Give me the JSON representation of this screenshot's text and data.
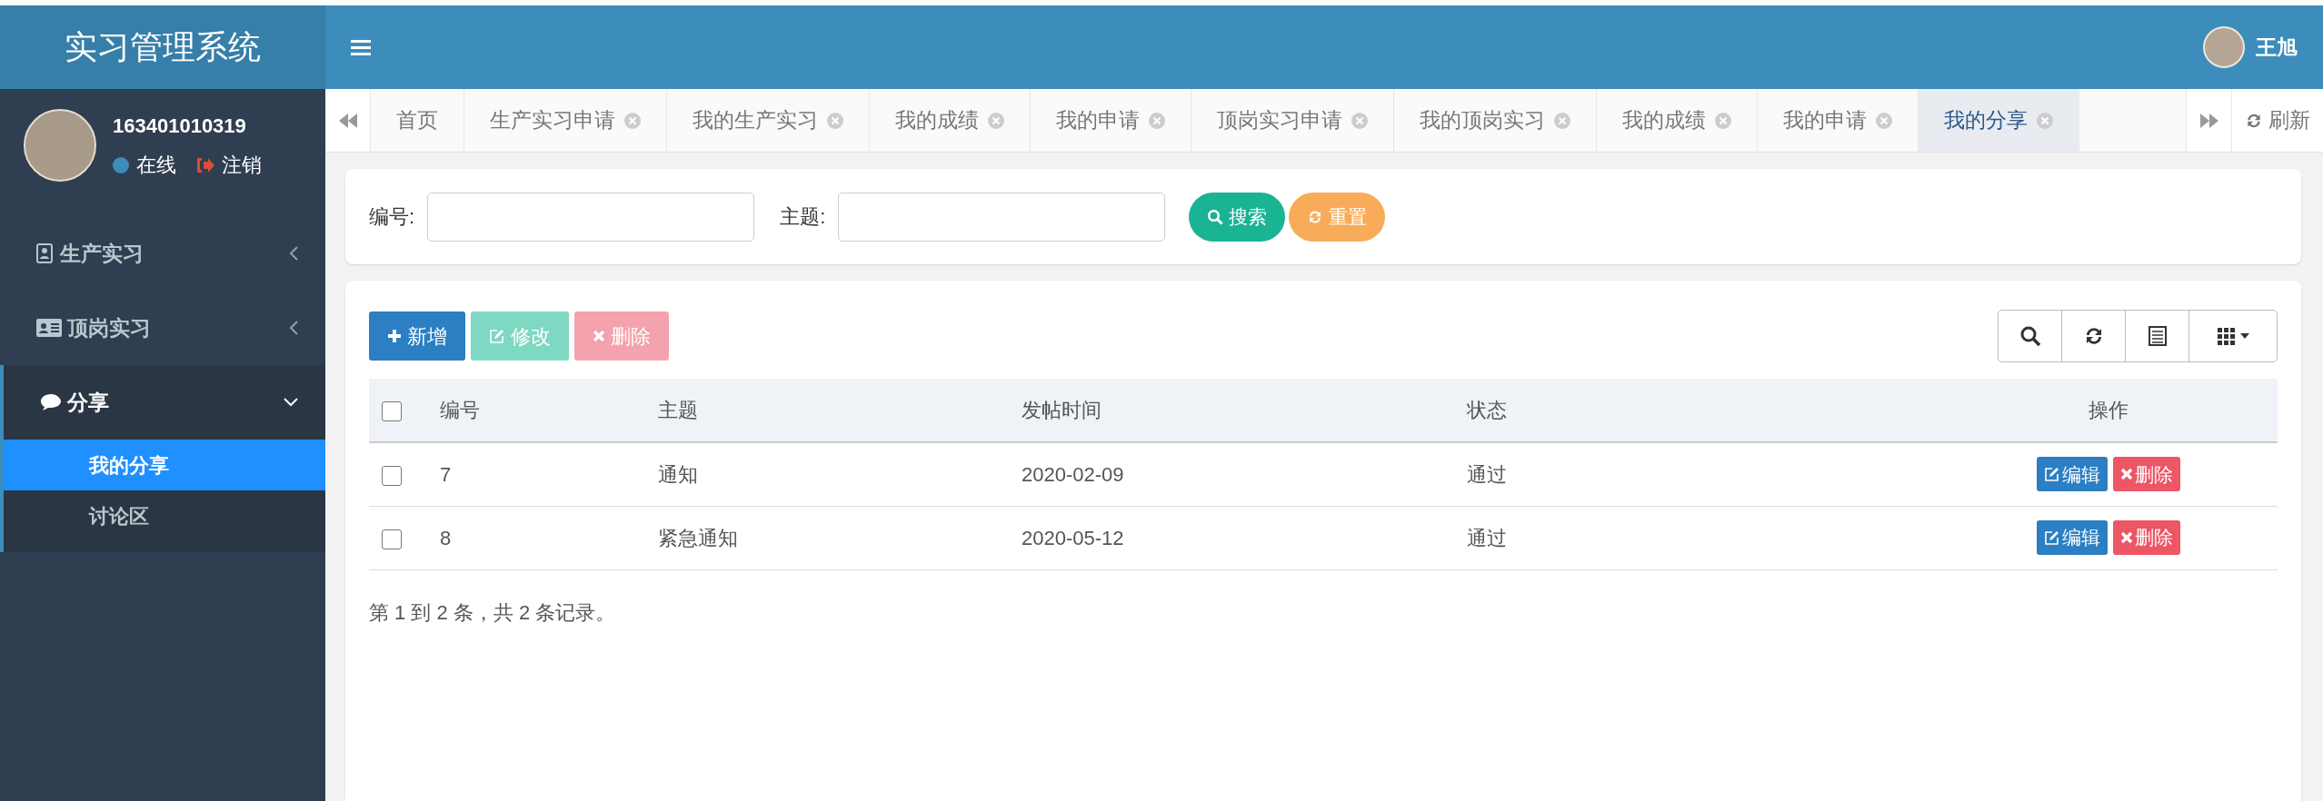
{
  "header": {
    "app_title": "实习管理系统",
    "user_name": "王旭"
  },
  "sidebar": {
    "user": {
      "id": "163401010319",
      "status": "在线",
      "logout": "注销"
    },
    "menu": [
      {
        "label": "生产实习",
        "expanded": false
      },
      {
        "label": "顶岗实习",
        "expanded": false
      },
      {
        "label": "分享",
        "expanded": true,
        "children": [
          {
            "label": "我的分享",
            "selected": true
          },
          {
            "label": "讨论区",
            "selected": false
          }
        ]
      }
    ]
  },
  "tabs": [
    {
      "label": "首页",
      "closable": false,
      "selected": false
    },
    {
      "label": "生产实习申请",
      "closable": true,
      "selected": false
    },
    {
      "label": "我的生产实习",
      "closable": true,
      "selected": false
    },
    {
      "label": "我的成绩",
      "closable": true,
      "selected": false
    },
    {
      "label": "我的申请",
      "closable": true,
      "selected": false
    },
    {
      "label": "顶岗实习申请",
      "closable": true,
      "selected": false
    },
    {
      "label": "我的顶岗实习",
      "closable": true,
      "selected": false
    },
    {
      "label": "我的成绩",
      "closable": true,
      "selected": false
    },
    {
      "label": "我的申请",
      "closable": true,
      "selected": false
    },
    {
      "label": "我的分享",
      "closable": true,
      "selected": true
    }
  ],
  "refresh": "刷新",
  "search": {
    "fields": [
      {
        "label": "编号:"
      },
      {
        "label": "主题:"
      }
    ],
    "search_button": "搜索",
    "reset_button": "重置"
  },
  "toolbar": {
    "add": "新增",
    "edit": "修改",
    "delete": "删除"
  },
  "table": {
    "select_all_checked": false,
    "columns": [
      "编号",
      "主题",
      "发帖时间",
      "状态",
      "操作"
    ],
    "rows": [
      {
        "checked": false,
        "cells": [
          "7",
          "通知",
          "2020-02-09",
          "通过"
        ],
        "edit": "编辑",
        "delete": "删除"
      },
      {
        "checked": false,
        "cells": [
          "8",
          "紧急通知",
          "2020-05-12",
          "通过"
        ],
        "edit": "编辑",
        "delete": "删除"
      }
    ]
  },
  "pagination": "第 1 到 2 条，共 2 条记录。"
}
